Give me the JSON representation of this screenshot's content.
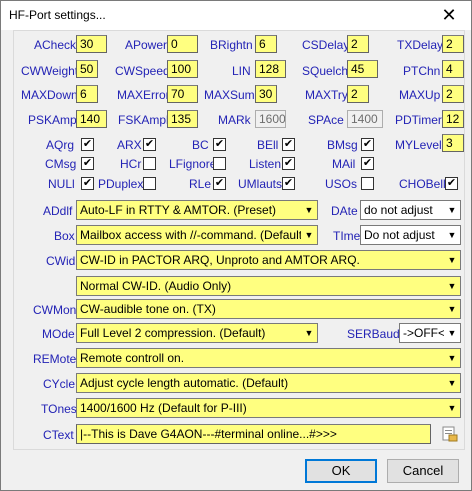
{
  "window": {
    "title": "HF-Port settings...",
    "close_glyph": "✕"
  },
  "fields": {
    "acheck": {
      "label": "ACheck",
      "value": "30"
    },
    "apower": {
      "label": "APower",
      "value": "0"
    },
    "brightn": {
      "label": "BRightn",
      "value": "6"
    },
    "csdelay": {
      "label": "CSDelay",
      "value": "2"
    },
    "txdelay": {
      "label": "TXDelay",
      "value": "2"
    },
    "cwweight": {
      "label": "CWWeight",
      "value": "50"
    },
    "cwspeed": {
      "label": "CWSpeed",
      "value": "100"
    },
    "lin": {
      "label": "LIN",
      "value": "128"
    },
    "squelch": {
      "label": "SQuelch",
      "value": "45"
    },
    "ptchn": {
      "label": "PTChn",
      "value": "4"
    },
    "maxdown": {
      "label": "MAXDown",
      "value": "6"
    },
    "maxerror": {
      "label": "MAXError",
      "value": "70"
    },
    "maxsum": {
      "label": "MAXSum",
      "value": "30"
    },
    "maxtry": {
      "label": "MAXTry",
      "value": "2"
    },
    "maxup": {
      "label": "MAXUp",
      "value": "2"
    },
    "pskampl": {
      "label": "PSKAmpl",
      "value": "140"
    },
    "fskampl": {
      "label": "FSKAmpl",
      "value": "135"
    },
    "mark": {
      "label": "MARk",
      "value": "1600"
    },
    "space": {
      "label": "SPAce",
      "value": "1400"
    },
    "pdtimer": {
      "label": "PDTimer",
      "value": "12"
    },
    "mylevel": {
      "label": "MYLevel",
      "value": "3"
    }
  },
  "checks": {
    "aqrg": {
      "label": "AQrg",
      "checked": true
    },
    "arx": {
      "label": "ARX",
      "checked": true
    },
    "bc": {
      "label": "BC",
      "checked": true
    },
    "bell": {
      "label": "BEll",
      "checked": true
    },
    "bmsg": {
      "label": "BMsg",
      "checked": true
    },
    "cmsg": {
      "label": "CMsg",
      "checked": true
    },
    "hcr": {
      "label": "HCr",
      "checked": false
    },
    "lfignore": {
      "label": "LFignore",
      "checked": false
    },
    "listen": {
      "label": "Listen",
      "checked": true
    },
    "mail": {
      "label": "MAil",
      "checked": true
    },
    "nuli": {
      "label": "NULl",
      "checked": true
    },
    "pduplex": {
      "label": "PDuplex",
      "checked": false
    },
    "rle": {
      "label": "RLe",
      "checked": true
    },
    "umlauts": {
      "label": "UMlauts",
      "checked": true
    },
    "usos": {
      "label": "USOs",
      "checked": false
    },
    "chobell": {
      "label": "CHOBell",
      "checked": true
    }
  },
  "combos": {
    "adelf": {
      "label": "ADdlf",
      "value": "Auto-LF in RTTY & AMTOR. (Preset)"
    },
    "date": {
      "label": "DAte",
      "value": "do not adjust"
    },
    "box": {
      "label": "Box",
      "value": "Mailbox access with //-command. (Default)"
    },
    "time": {
      "label": "TIme",
      "value": "Do not adjust"
    },
    "cwid": {
      "label": "CWid",
      "value": "CW-ID in PACTOR ARQ, Unproto and AMTOR ARQ."
    },
    "cwid2": {
      "value": "Normal CW-ID. (Audio Only)"
    },
    "cwmoni": {
      "label": "CWMoni",
      "value": "CW-audible tone on. (TX)"
    },
    "mode": {
      "label": "MOde",
      "value": "Full Level 2 compression. (Default)"
    },
    "serbaud": {
      "label": "SERBaud",
      "value": "->OFF<-"
    },
    "remote": {
      "label": "REMote",
      "value": "Remote controll on."
    },
    "cycle": {
      "label": "CYcle",
      "value": "Adjust cycle length automatic. (Default)"
    },
    "tones": {
      "label": "TOnes",
      "value": "1400/1600 Hz (Default for P-III)"
    }
  },
  "ctext": {
    "label": "CText",
    "value": "|--This is Dave G4AON---#terminal online...#>>>"
  },
  "buttons": {
    "ok": "OK",
    "cancel": "Cancel"
  },
  "colors": {
    "label": "#2323b5",
    "field": "#ffff80",
    "annotation": "#c8102e"
  }
}
